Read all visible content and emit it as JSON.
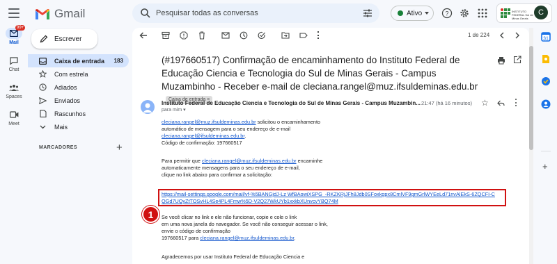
{
  "app": {
    "name": "Gmail",
    "search_placeholder": "Pesquisar todas as conversas",
    "status_label": "Ativo",
    "org_name": "INSTITUTO FEDERAL Sul de Minas Gerais",
    "avatar_letter": "C"
  },
  "rail": {
    "mail_label": "Mail",
    "mail_badge": "99+",
    "chat_label": "Chat",
    "spaces_label": "Spaces",
    "meet_label": "Meet"
  },
  "sidebar": {
    "compose_label": "Escrever",
    "items": [
      {
        "label": "Caixa de entrada",
        "count": "183"
      },
      {
        "label": "Com estrela",
        "count": ""
      },
      {
        "label": "Adiados",
        "count": ""
      },
      {
        "label": "Enviados",
        "count": ""
      },
      {
        "label": "Rascunhos",
        "count": ""
      },
      {
        "label": "Mais",
        "count": ""
      }
    ],
    "labels_header": "MARCADORES"
  },
  "toolbar": {
    "pager": "1 de 224"
  },
  "email": {
    "subject": "(#197660517) Confirmação de encaminhamento do Instituto Federal de Educação Ciencia e Tecnologia do Sul de Minas Gerais - Campus Muzambinho - Receber e-mail de cleciana.rangel@muz.ifsuldeminas.edu.br",
    "label_chip": "Caixa de entrada",
    "sender": "Instituto Federal de Educação Ciencia e Tecnologia do Sul de Minas Gerais - Campus Muzambin...",
    "time": "21:47 (há 16 minutos)",
    "to": "para mim",
    "p1_link": "cleciana.rangel@muz.ifsuldeminas.edu.br",
    "p1_line1_rest": " solicitou o encaminhamento",
    "p1_line2": "automático de mensagem para o seu endereço de e-mail",
    "p1_line3_link": "cleciana.rangel@ifsuldeminas.edu.br",
    "p1_line3_rest": ".",
    "p1_line4": "Código de confirmação: 197660517",
    "p2_line1_pre": "Para permitir que ",
    "p2_line1_link": "cleciana.rangel@muz.ifsuldeminas.edu.br",
    "p2_line1_rest": " encaminhe",
    "p2_line2": "automaticamente mensagens para o seu endereço de e-mail,",
    "p2_line3": "clique no link abaixo para confirmar a solicitação:",
    "verify_link": "https://mail-settings.google.com/mail/vf-%5BANGjdJ-Lz WfBAowiXSPG_-RKZKRjJFh8Jdb0SFoxkgpx8CmlVF9gmGrlWYEeLd71nvAlEkS-6ZQCFI-CQGd7UQyZtTOSvHL4Se4PL4Fmw%5D-V2Q27WkUYb1xxkbXUnvcvYBQ74M",
    "marker": "1",
    "p3_line1": "Se você clicar no link e ele não funcionar, copie e cole o link",
    "p3_line2": "em uma nova janela do navegador. Se você não conseguir acessar o link,",
    "p3_line3": "envie o código de confirmação",
    "p3_line4_pre": "197660517 para ",
    "p3_line4_link": "cleciana.rangel@muz.ifsuldeminas.edu.br",
    "p3_line4_rest": ".",
    "p4_line1": "Agradecemos por usar Instituto Federal de Educação Ciencia e"
  }
}
